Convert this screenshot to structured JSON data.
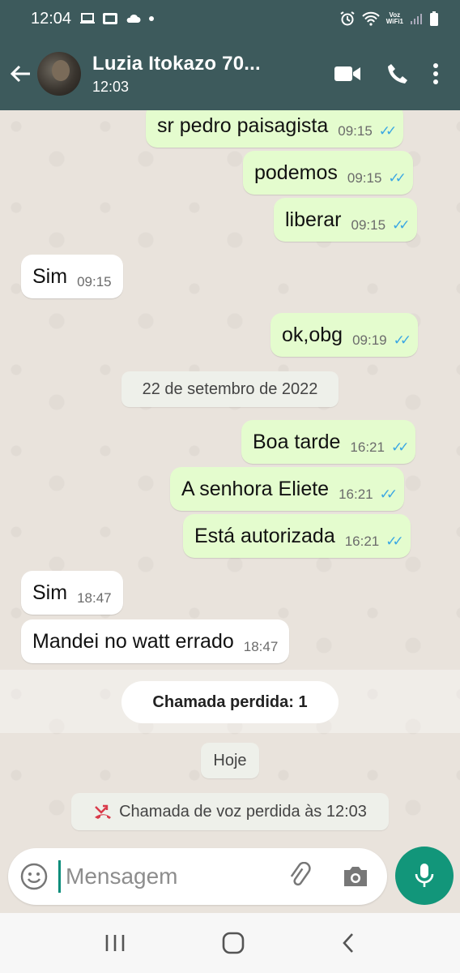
{
  "status_bar": {
    "time": "12:04",
    "voz_line1": "Voz",
    "voz_line2": "WiFi1"
  },
  "header": {
    "contact_name": "Luzia Itokazo 70...",
    "last_seen": "12:03"
  },
  "messages": [
    {
      "text": "sr pedro paisagista",
      "time": "09:15",
      "direction": "out",
      "read": true
    },
    {
      "text": "podemos",
      "time": "09:15",
      "direction": "out",
      "read": true
    },
    {
      "text": "liberar",
      "time": "09:15",
      "direction": "out",
      "read": true
    },
    {
      "text": "Sim",
      "time": "09:15",
      "direction": "in"
    },
    {
      "text": "ok,obg",
      "time": "09:19",
      "direction": "out",
      "read": true
    },
    {
      "text": "Boa tarde",
      "time": "16:21",
      "direction": "out",
      "read": true
    },
    {
      "text": "A senhora  Eliete",
      "time": "16:21",
      "direction": "out",
      "read": true
    },
    {
      "text": "Está autorizada",
      "time": "16:21",
      "direction": "out",
      "read": true
    },
    {
      "text": "Sim",
      "time": "18:47",
      "direction": "in"
    },
    {
      "text": "Mandei no watt errado",
      "time": "18:47",
      "direction": "in"
    }
  ],
  "date_separator_1": "22 de setembro de 2022",
  "missed_calls_banner": "Chamada perdida: 1",
  "date_separator_today": "Hoje",
  "missed_voice_call": "Chamada de voz perdida às 12:03",
  "composer": {
    "placeholder": "Mensagem"
  },
  "colors": {
    "header_bg": "#3d5a5c",
    "outgoing_bubble": "#e4fcce",
    "incoming_bubble": "#ffffff",
    "accent": "#12967a",
    "read_ticks": "#3ba7e3",
    "missed_call_icon": "#d93a4a"
  },
  "icons": [
    "back-arrow-icon",
    "video-call-icon",
    "voice-call-icon",
    "more-options-icon",
    "emoji-icon",
    "attach-icon",
    "camera-icon",
    "mic-icon",
    "missed-call-icon",
    "recents-icon",
    "home-icon",
    "back-nav-icon"
  ]
}
